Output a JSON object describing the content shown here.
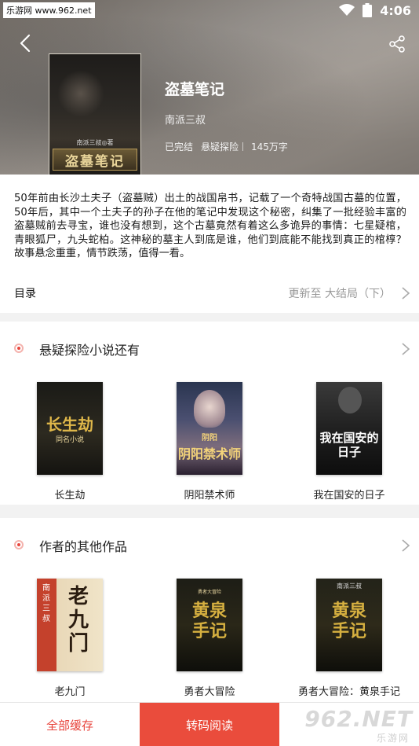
{
  "status_bar": {
    "site": "乐游网 www.962.net",
    "time": "4:06"
  },
  "book": {
    "title": "盗墓笔记",
    "author": "南派三叔",
    "status": "已完结",
    "category": "悬疑探险",
    "word_count": "145万字",
    "cover_title": "盗墓笔记",
    "cover_author": "南派三叔◎著"
  },
  "description": "50年前由长沙土夫子（盗墓贼）出土的战国帛书，记载了一个奇特战国古墓的位置，50年后，其中一个土夫子的孙子在他的笔记中发现这个秘密，纠集了一批经验丰富的盗墓贼前去寻宝，谁也没有想到，这个古墓竟然有着这么多诡异的事情：七星疑棺，青眼狐尸，九头蛇柏。这神秘的墓主人到底是谁，他们到底能不能找到真正的棺椁？故事悬念重重，情节跌荡，值得一看。",
  "toc": {
    "label": "目录",
    "update": "更新至 大结局（下）"
  },
  "section_similar": {
    "title": "悬疑探险小说还有",
    "books": [
      {
        "name": "长生劫",
        "cover_title": "长生劫",
        "cover_sub": "同名小说"
      },
      {
        "name": "阴阳禁术师",
        "cover_title": "阴阳禁术师",
        "cover_sub": "阴阳"
      },
      {
        "name": "我在国安的日子",
        "cover_title": "我在国安的日子",
        "cover_sub": ""
      }
    ]
  },
  "section_author": {
    "title": "作者的其他作品",
    "books": [
      {
        "name": "老九门",
        "cover_title": "老九门",
        "cover_sub": "南派三叔"
      },
      {
        "name": "勇者大冒险",
        "cover_title": "黄泉手记",
        "cover_sub": "勇者大冒险"
      },
      {
        "name": "勇者大冒险：黄泉手记",
        "cover_title": "黄泉手记",
        "cover_sub": "南派三叔"
      }
    ]
  },
  "bottom": {
    "cache": "全部缓存",
    "read": "转码阅读"
  },
  "watermark": {
    "main": "962.NET",
    "sub": "乐游网"
  },
  "colors": {
    "accent": "#ea4c3c"
  }
}
